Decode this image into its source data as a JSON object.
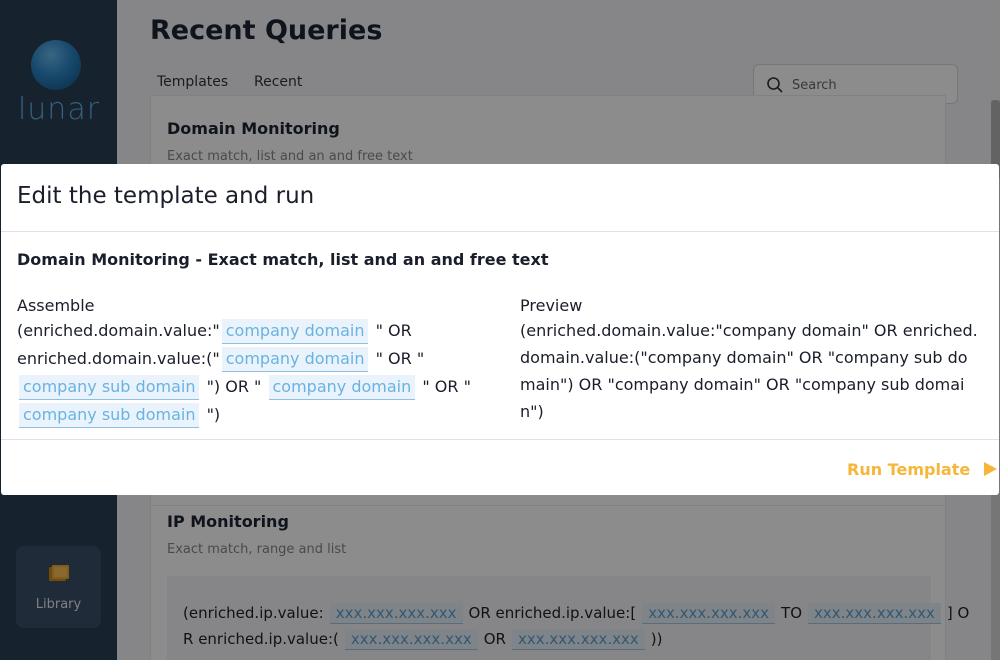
{
  "sidebar": {
    "logo_text": "lunar",
    "library_label": "Library"
  },
  "page": {
    "title": "Recent Queries",
    "tabs": [
      {
        "label": "Templates",
        "active": true
      },
      {
        "label": "Recent",
        "active": false
      }
    ],
    "search_placeholder": "Search"
  },
  "cards": [
    {
      "title": "Domain Monitoring",
      "subtitle": "Exact match, list and an and free text"
    },
    {
      "title": "IP Monitoring",
      "subtitle": "Exact match, range and list",
      "code": {
        "t1": "(enriched.ip.value:",
        "c1": "xxx.xxx.xxx.xxx",
        "t2": "OR enriched.ip.value:[",
        "c2": "xxx.xxx.xxx.xxx",
        "t3": "TO",
        "c3": "xxx.xxx.xxx.xxx",
        "t4": "] O",
        "t5": "R enriched.ip.value:(",
        "c4": "xxx.xxx.xxx.xxx",
        "t6": "OR",
        "c5": "xxx.xxx.xxx.xxx",
        "t7": "))"
      }
    }
  ],
  "modal": {
    "title": "Edit the template and run",
    "subtitle": "Domain Monitoring - Exact match, list and an and free text",
    "assemble_label": "Assemble",
    "preview_label": "Preview",
    "assemble": {
      "t1": "(enriched.domain.value:\"",
      "chip1": "company domain",
      "t2": "\" OR enriched.domain.value:(\"",
      "chip2": "company domain",
      "t3": "\" OR \"",
      "chip3": "company sub domain",
      "t4": "\") OR \"",
      "chip4": "company domain",
      "t5": "\" OR \"",
      "chip5": "company sub domain",
      "t6": "\")"
    },
    "preview_text": "(enriched.domain.value:\"company domain\" OR enriched.domain.value:(\"company domain\" OR \"company sub domain\") OR \"company domain\" OR \"company sub domain\")",
    "run_label": "Run Template"
  },
  "colors": {
    "sidebar": "#2a3f57",
    "accent": "#f6b637",
    "chip_text": "#68b3e3"
  }
}
